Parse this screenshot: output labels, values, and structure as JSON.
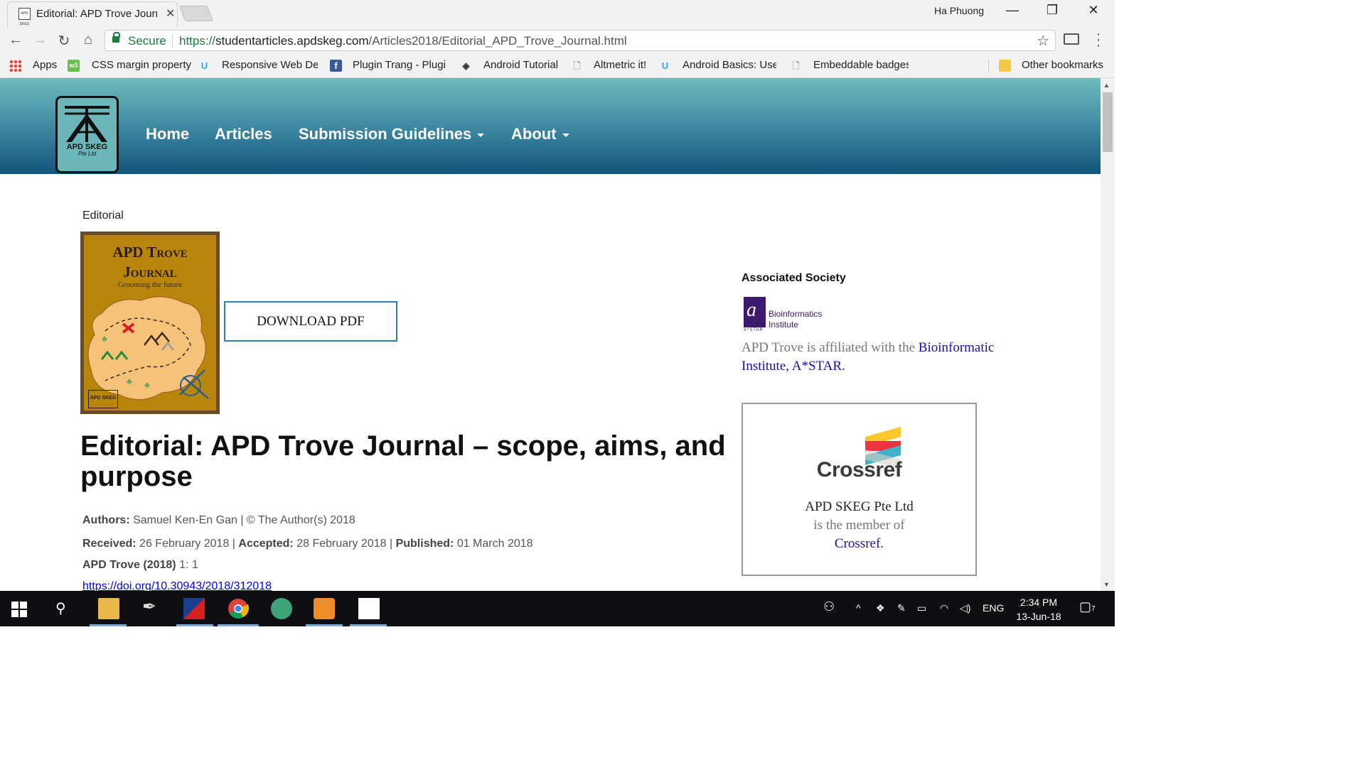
{
  "browser": {
    "tab_title": "Editorial: APD Trove Journ",
    "favicon_text": "APD SKEG",
    "profile_name": "Ha Phuong",
    "secure_label": "Secure",
    "url_scheme": "https://",
    "url_host": "studentarticles.apdskeg.com",
    "url_path": "/Articles2018/Editorial_APD_Trove_Journal.html",
    "bookmarks": [
      {
        "label": "Apps"
      },
      {
        "label": "CSS margin property"
      },
      {
        "label": "Responsive Web Des"
      },
      {
        "label": "Plugin Trang - Plugi"
      },
      {
        "label": "Android Tutorial"
      },
      {
        "label": "Altmetric it!"
      },
      {
        "label": "Android Basics: User"
      },
      {
        "label": "Embeddable badges"
      },
      {
        "label": "Other bookmarks"
      }
    ]
  },
  "site": {
    "logo_line1": "APD SKEG",
    "logo_line2": "Pte Ltd",
    "nav": [
      {
        "label": "Home"
      },
      {
        "label": "Articles"
      },
      {
        "label": "Submission Guidelines"
      },
      {
        "label": "About"
      }
    ]
  },
  "article": {
    "breadcrumb": "Editorial",
    "cover_title_1": "APD Trove",
    "cover_title_2": "Journal",
    "cover_subtitle": "Grooming the future",
    "cover_badge": "APD SKEG",
    "download_label": "DOWNLOAD PDF",
    "title": "Editorial: APD Trove Journal – scope, aims, and purpose",
    "authors_label": "Authors:",
    "authors": "Samuel Ken-En Gan",
    "copyright": "| © The Author(s) 2018",
    "received_label": "Received:",
    "received": "26 February 2018",
    "accepted_label": "Accepted:",
    "accepted": "28 February 2018",
    "published_label": "Published:",
    "published": "01 March 2018",
    "citation_label": "APD Trove (2018)",
    "citation": "1: 1",
    "doi": "https://doi.org/10.30943/2018/312018"
  },
  "sidebar": {
    "society_heading": "Associated Society",
    "bii_name_1": "Bioinformatics",
    "bii_name_2": "Institute",
    "bii_astar": "A*STAR",
    "aff_text": "APD Trove is affiliated with the",
    "aff_link": "Bioinformatic Institute, A*STAR.",
    "crossref_word": "Crossref",
    "crossref_line1": "APD SKEG Pte Ltd",
    "crossref_line2": "is the member of",
    "crossref_link": "Crossref."
  },
  "taskbar": {
    "language": "ENG",
    "time": "2:34 PM",
    "date": "13-Jun-18",
    "notification_count": "7"
  },
  "colors": {
    "header_top": "#6dbcbc",
    "header_bottom": "#12557a",
    "download_border": "#2d7fa9",
    "link": "#1a0dab",
    "secure_green": "#188038"
  }
}
